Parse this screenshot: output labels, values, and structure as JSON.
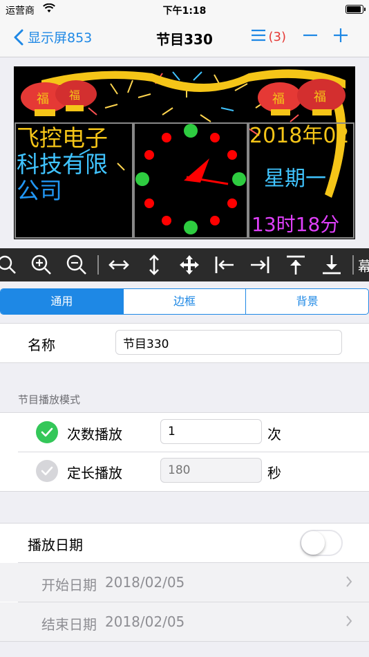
{
  "status_bar": {
    "carrier": "运营商",
    "time": "下午1:18",
    "battery_level": 0.9
  },
  "nav": {
    "back_label": "显示屏853",
    "title": "节目330",
    "list_count": "(3)"
  },
  "preview": {
    "text_left_lines": [
      "飞控电子",
      "科技有限",
      "公司"
    ],
    "date_text": "2018年02",
    "weekday_text": "星期一",
    "time_text": "13时18分",
    "lantern_text": "福"
  },
  "toolbar": {
    "icons": [
      "search-icon",
      "zoom-in-icon",
      "zoom-out-icon",
      "stretch-horizontal-icon",
      "stretch-vertical-icon",
      "move-icon",
      "align-left-icon",
      "align-right-icon",
      "align-top-icon",
      "align-bottom-icon"
    ],
    "cut_text": "幕"
  },
  "tabs": [
    {
      "label": "通用",
      "active": true
    },
    {
      "label": "边框",
      "active": false
    },
    {
      "label": "背景",
      "active": false
    }
  ],
  "form": {
    "name_label": "名称",
    "name_value": "节目330",
    "mode_header": "节目播放模式",
    "count_mode_label": "次数播放",
    "count_value": "1",
    "count_unit": "次",
    "duration_mode_label": "定长播放",
    "duration_placeholder": "180",
    "duration_unit": "秒",
    "date_label": "播放日期",
    "date_enabled": false,
    "start_label": "开始日期",
    "start_value": "2018/02/05",
    "end_label": "结束日期",
    "end_value": "2018/02/05"
  },
  "colors": {
    "accent": "#1e88e5",
    "badge": "#e53935",
    "check_on": "#34c759"
  }
}
